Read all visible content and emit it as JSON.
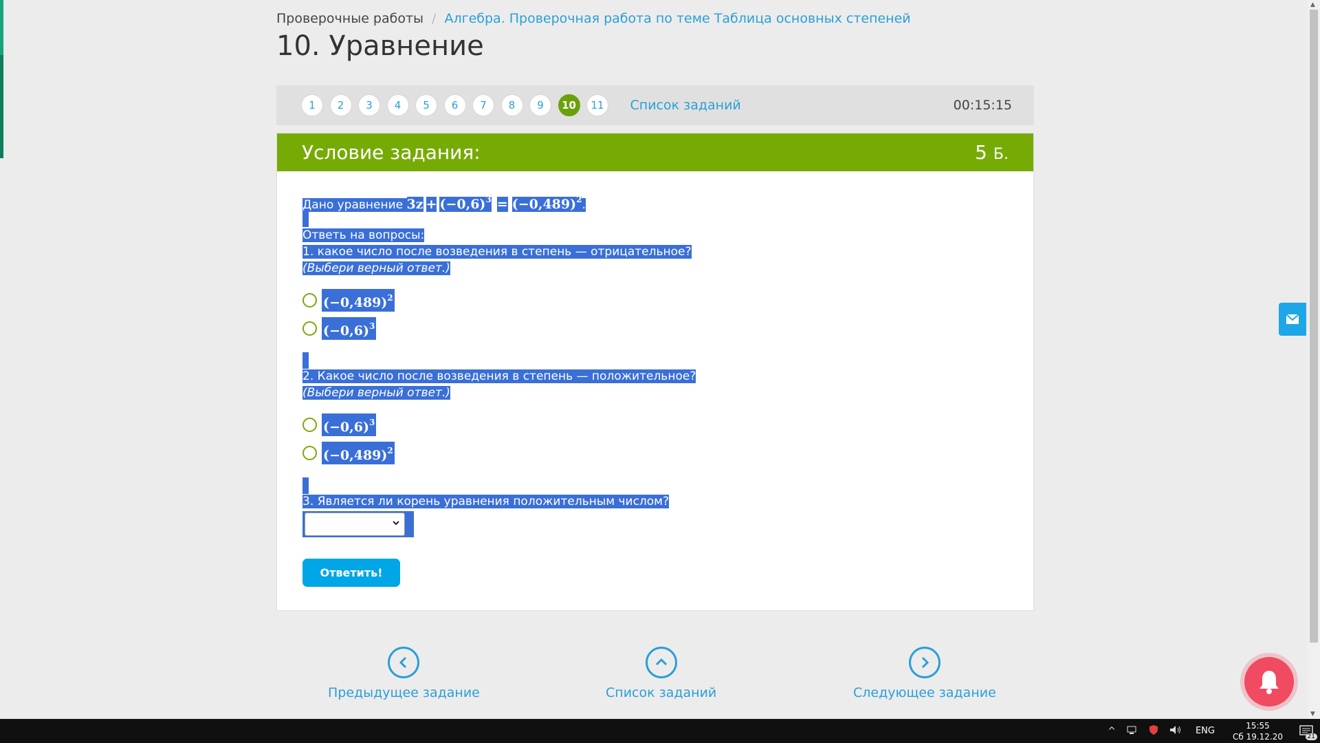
{
  "breadcrumb": {
    "root": "Проверочные работы",
    "separator": "/",
    "current": "Алгебра. Проверочная работа по теме Таблица основных степеней"
  },
  "page_title": "10. Уравнение",
  "task_nav": {
    "numbers": [
      "1",
      "2",
      "3",
      "4",
      "5",
      "6",
      "7",
      "8",
      "9",
      "10",
      "11"
    ],
    "active": "10",
    "list_link": "Список заданий",
    "timer": "00:15:15"
  },
  "task": {
    "header_title": "Условие задания:",
    "points": "5",
    "points_unit": "Б.",
    "intro": "Дано уравнение ",
    "equation": {
      "lhs_var": "3z",
      "plus": "+",
      "term1": "(−0,6)",
      "term1_exp": "3",
      "eq": "=",
      "term2": "(−0,489)",
      "term2_exp": "2",
      "period": "."
    },
    "instructions": "Ответь на вопросы:",
    "q1": {
      "text": "1. какое число после возведения в степень — отрицательное?",
      "hint": "(Выбери верный ответ.)",
      "options": [
        {
          "base": "(−0,489)",
          "exp": "2"
        },
        {
          "base": "(−0,6)",
          "exp": "3"
        }
      ]
    },
    "q2": {
      "text": "2. Какое число после возведения в степень — положительное?",
      "hint": "(Выбери верный ответ.)",
      "options": [
        {
          "base": "(−0,6)",
          "exp": "3"
        },
        {
          "base": "(−0,489)",
          "exp": "2"
        }
      ]
    },
    "q3": {
      "text": "3. Является ли корень уравнения положительным числом?",
      "select_value": ""
    },
    "answer_button": "Ответить!"
  },
  "bottom_nav": {
    "prev": "Предыдущее задание",
    "list": "Список заданий",
    "next": "Следующее задание"
  },
  "taskbar": {
    "lang": "ENG",
    "time": "15:55",
    "date": "Сб 19.12.20",
    "notifications": "21"
  },
  "colors": {
    "accent_green": "#76ab06",
    "link_blue": "#2a9fd6",
    "selection": "#3a6fd8",
    "button_blue": "#00a6e6",
    "bell_red": "#f04b61"
  }
}
